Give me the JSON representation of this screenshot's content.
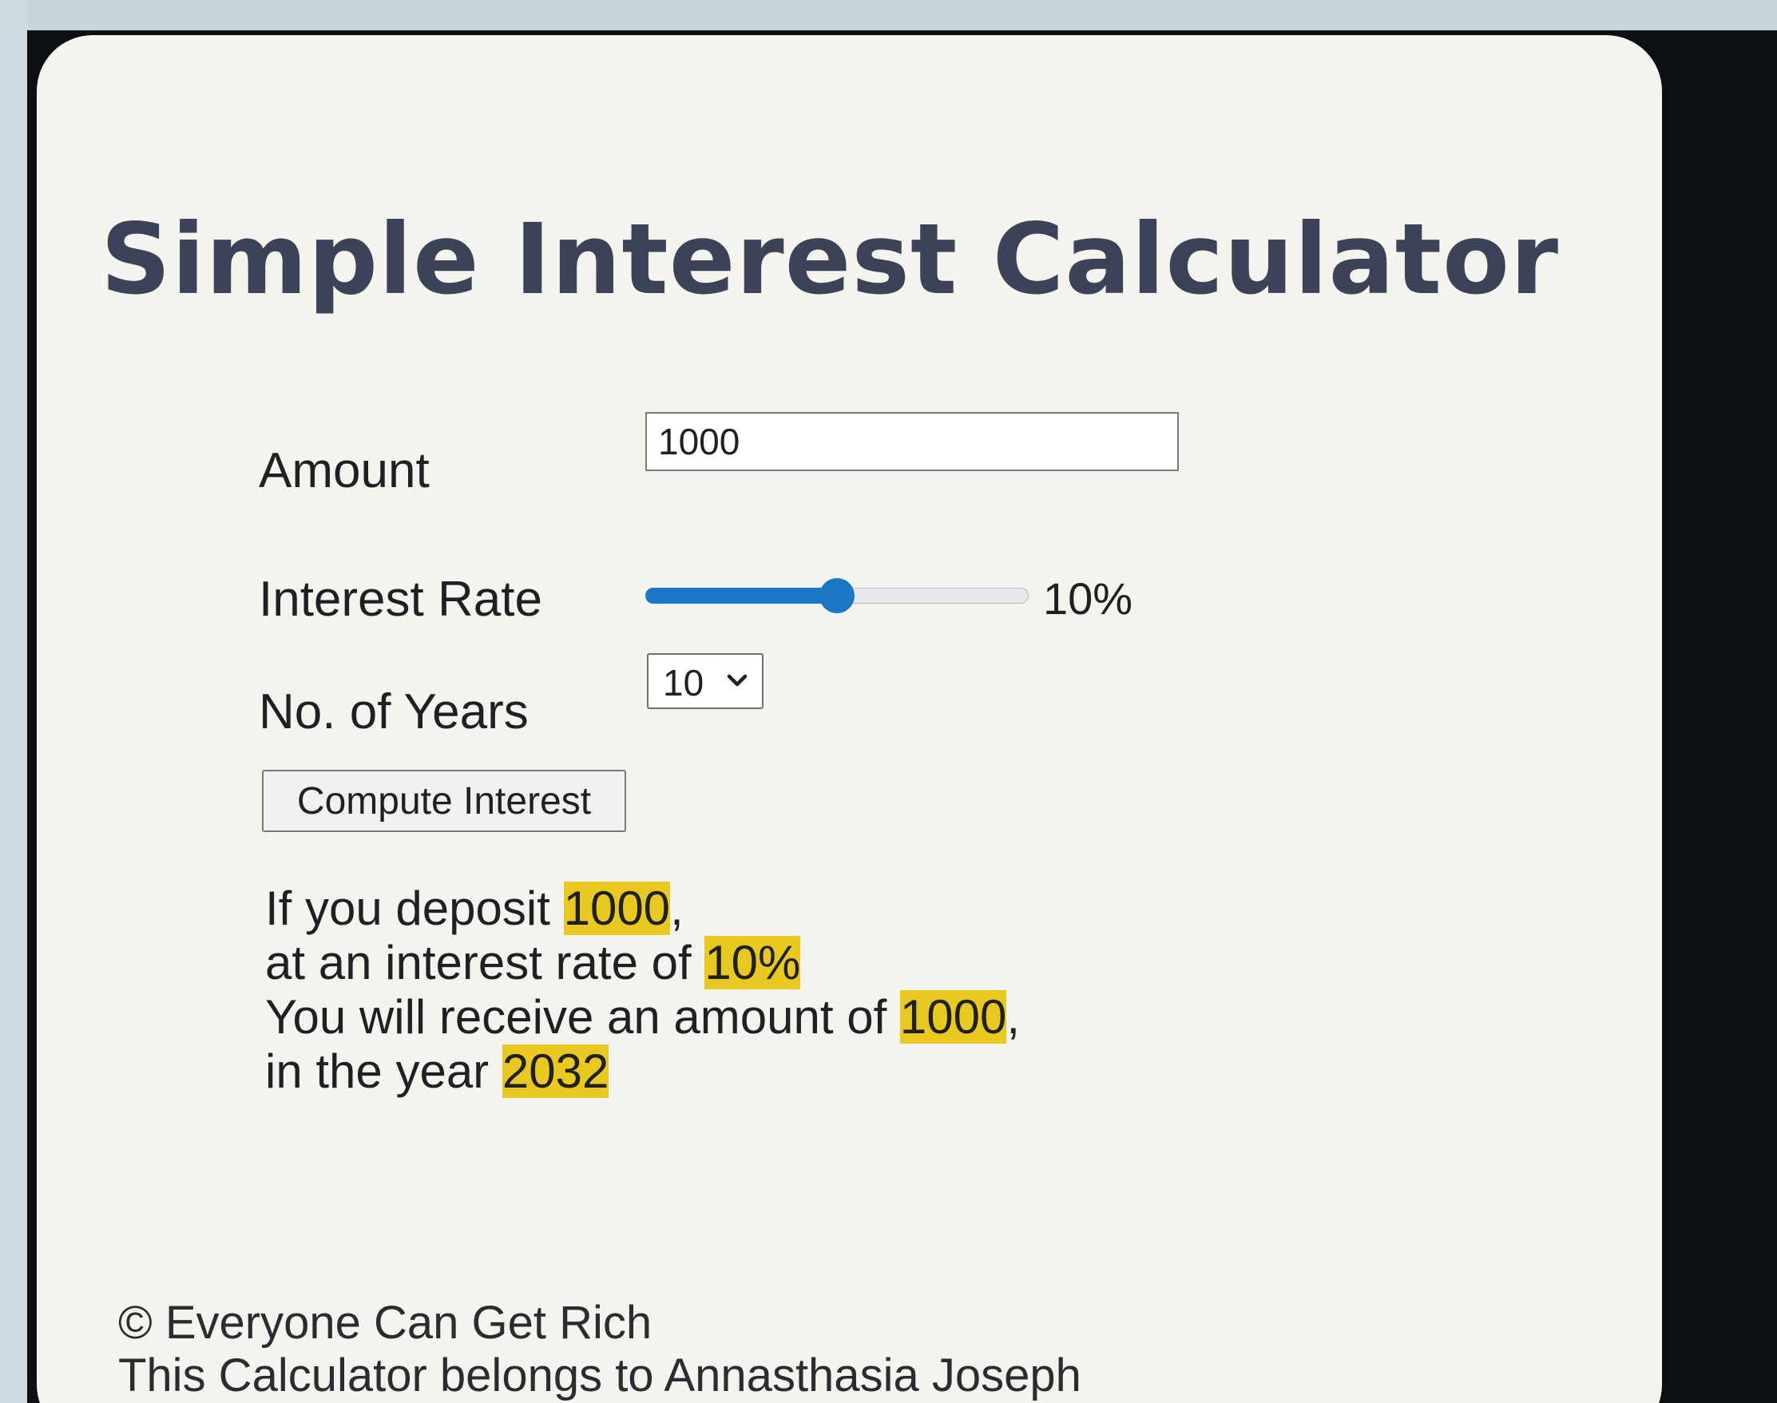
{
  "title": "Simple Interest Calculator",
  "form": {
    "amount_label": "Amount",
    "amount_value": "1000",
    "rate_label": "Interest Rate",
    "rate_value": 10,
    "rate_max": 20,
    "rate_display": "10%",
    "years_label": "No. of Years",
    "years_selected": "10",
    "compute_label": "Compute Interest"
  },
  "result": {
    "line1_prefix": "If you deposit ",
    "deposit": "1000",
    "line1_suffix": ",",
    "line2_prefix": "at an interest rate of ",
    "rate": "10%",
    "line3_prefix": "You will receive an amount of ",
    "amount": "1000",
    "line3_suffix": ",",
    "line4_prefix": "in the year ",
    "year": "2032"
  },
  "footer": {
    "copyright": "© Everyone Can Get Rich",
    "owner": "This Calculator belongs to Annasthasia Joseph"
  },
  "colors": {
    "accent": "#1a78c6",
    "highlight": "#e9c81f",
    "title": "#3c4257"
  }
}
